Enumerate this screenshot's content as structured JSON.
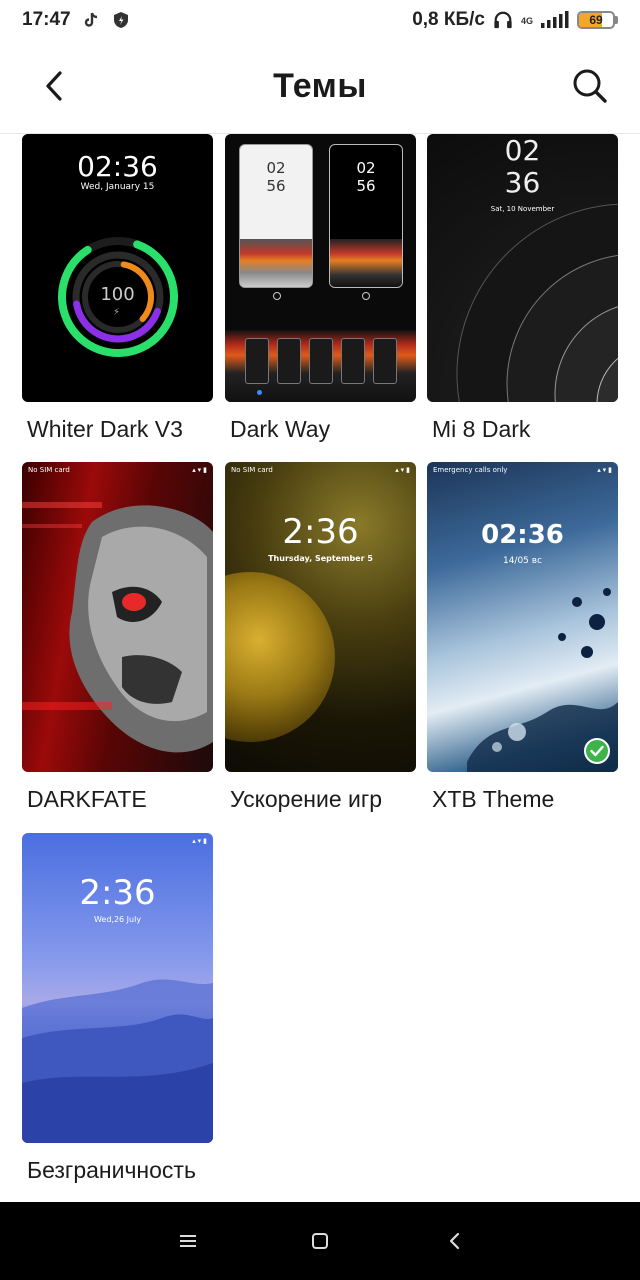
{
  "status_bar": {
    "time": "17:47",
    "speed": "0,8 КБ/с",
    "network": "4G",
    "battery": "69",
    "battery_level": 0.69
  },
  "header": {
    "title": "Темы",
    "back_icon": "chevron-left-icon",
    "search_icon": "search-icon"
  },
  "themes": [
    {
      "name": "Whiter Dark V3",
      "clock": "02:36",
      "date": "Wed, January 15",
      "ring_value": "100"
    },
    {
      "name": "Dark Way",
      "clock_h": "02",
      "clock_m": "56"
    },
    {
      "name": "Mi 8 Dark",
      "clock_h": "02",
      "clock_m": "36",
      "date": "Sat, 10 November"
    },
    {
      "name": "DARKFATE",
      "sim": "No SIM card"
    },
    {
      "name": "Ускорение игр",
      "sim": "No SIM card",
      "clock": "2:36",
      "date": "Thursday, September 5"
    },
    {
      "name": "XTB Theme",
      "sim": "Emergency calls only",
      "clock": "02:36",
      "date": "14/05 вс",
      "selected": true
    },
    {
      "name": "Безграничность",
      "clock": "2:36",
      "date": "Wed,26  July"
    }
  ],
  "navbar": {
    "menu_icon": "menu-icon",
    "home_icon": "home-square-icon",
    "back_icon": "back-triangle-icon"
  },
  "colors": {
    "accent_check": "#3db34a",
    "battery": "#f4a62a"
  }
}
